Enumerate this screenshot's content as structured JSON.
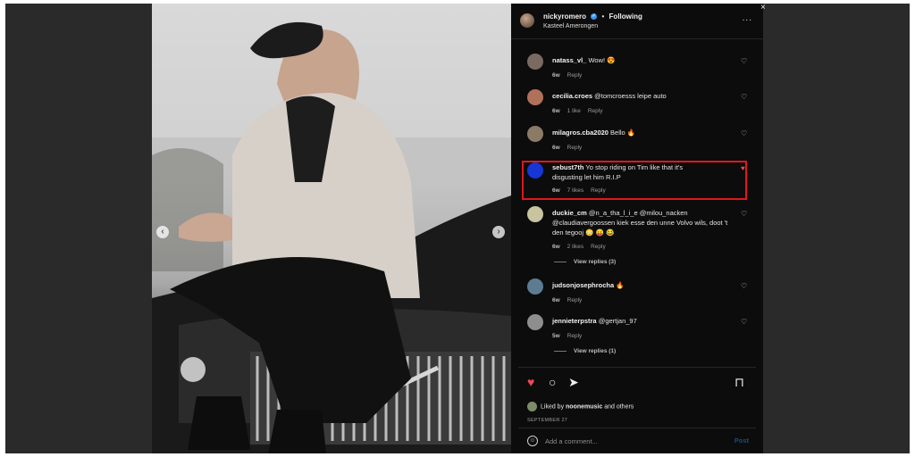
{
  "post": {
    "username": "nickyromero",
    "following_label": "Following",
    "location": "Kasteel Amerongen",
    "more_label": "...",
    "prev_arrow": "‹",
    "next_arrow": "›"
  },
  "comments": [
    {
      "user": "natass_vl_",
      "text": "Wow! 😍",
      "age": "6w",
      "likes": "",
      "reply": "Reply",
      "liked": false,
      "avatar_color": "#7a6a62"
    },
    {
      "user": "cecilia.croes",
      "text": "@tomcroesss leipe auto",
      "age": "6w",
      "likes": "1 like",
      "reply": "Reply",
      "liked": false,
      "avatar_color": "#b0705a"
    },
    {
      "user": "milagros.cba2020",
      "text": "Bello 🔥",
      "age": "6w",
      "likes": "",
      "reply": "Reply",
      "liked": false,
      "avatar_color": "#8b7a66"
    },
    {
      "user": "sebust7th",
      "text": "Yo stop riding on Tim like that it's disgusting let him R.I.P",
      "age": "6w",
      "likes": "7 likes",
      "reply": "Reply",
      "liked": true,
      "avatar_color": "#1636d6"
    },
    {
      "user": "duckie_cm",
      "text": "@n_a_tha_l_i_e @milou_nacken @claudiavergoossen kiek esse den unne Volvo wils, doot 't den tegooj 😳 😛 😂",
      "age": "6w",
      "likes": "2 likes",
      "reply": "Reply",
      "liked": false,
      "avatar_color": "#c9c4a0"
    },
    {
      "user": "judsonjosephrocha",
      "text": "🔥",
      "age": "6w",
      "likes": "",
      "reply": "Reply",
      "liked": false,
      "avatar_color": "#5d7c92"
    },
    {
      "user": "jennieterpstra",
      "text": "@gertjan_97",
      "age": "5w",
      "likes": "",
      "reply": "Reply",
      "liked": false,
      "avatar_color": "#8e8e8e"
    }
  ],
  "view_replies": [
    "View replies (3)",
    "View replies (1)"
  ],
  "actions": {
    "liked_by_prefix": "Liked by",
    "liked_by_user": "noonemusic",
    "liked_by_suffix": "and others",
    "date": "SEPTEMBER 27"
  },
  "comment_box": {
    "placeholder": "Add a comment...",
    "post_label": "Post"
  },
  "colors": {
    "highlight": "#e3161c",
    "heart_active": "#ed4956",
    "verified": "#3897f0"
  },
  "icons": [
    "heart-icon",
    "comment-icon",
    "share-icon",
    "bookmark-icon",
    "smiley-icon",
    "more-icon",
    "verified-icon",
    "close-icon"
  ]
}
